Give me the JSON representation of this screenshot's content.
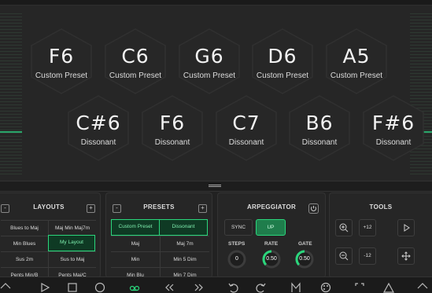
{
  "pads": {
    "row1": [
      {
        "note": "F6",
        "label": "Custom Preset"
      },
      {
        "note": "C6",
        "label": "Custom Preset"
      },
      {
        "note": "G6",
        "label": "Custom Preset"
      },
      {
        "note": "D6",
        "label": "Custom Preset"
      },
      {
        "note": "A5",
        "label": "Custom Preset"
      }
    ],
    "row2": [
      {
        "note": "C#6",
        "label": "Dissonant"
      },
      {
        "note": "F6",
        "label": "Dissonant"
      },
      {
        "note": "C7",
        "label": "Dissonant"
      },
      {
        "note": "B6",
        "label": "Dissonant"
      },
      {
        "note": "F#6",
        "label": "Dissonant"
      }
    ]
  },
  "layouts": {
    "title": "LAYOUTS",
    "minus": "-",
    "plus": "+",
    "items": [
      "Blues to Maj",
      "Maj Min Maj7m",
      "Min Blues",
      "My Layout",
      "Sus 2m",
      "Sus to Maj",
      "Pents Min/B",
      "Pents Maj/C"
    ],
    "selected": "My Layout"
  },
  "presets": {
    "title": "PRESETS",
    "minus": "-",
    "plus": "+",
    "items": [
      "Custom Preset",
      "Dissonant",
      "Maj",
      "Maj 7m",
      "Min",
      "Min 5 Dim",
      "Min Blu",
      "Min 7 Dim"
    ],
    "selected": [
      "Custom Preset",
      "Dissonant"
    ]
  },
  "arpeggiator": {
    "title": "ARPEGGIATOR",
    "sync": "SYNC",
    "up": "UP",
    "steps_label": "STEPS",
    "rate_label": "RATE",
    "gate_label": "GATE",
    "steps": "0",
    "rate": "0.50",
    "gate": "0.50",
    "rate_level": 0.5,
    "gate_level": 0.5,
    "accent": "#2bd67c"
  },
  "tools": {
    "title": "TOOLS",
    "transpose_up": "+12",
    "transpose_down": "-12"
  }
}
